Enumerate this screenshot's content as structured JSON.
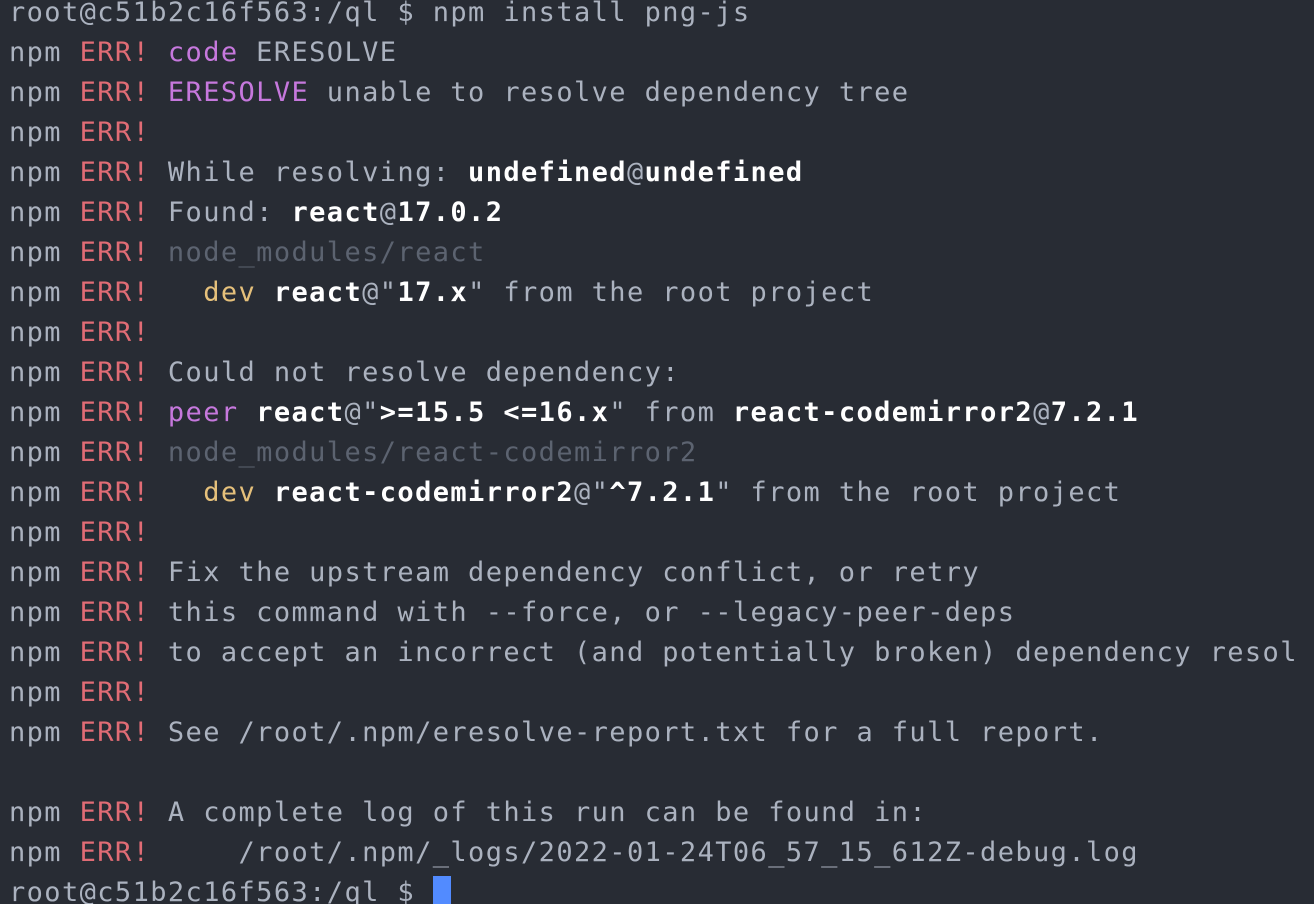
{
  "window": {
    "title": ""
  },
  "colors": {
    "background": "#282c34",
    "default": "#abb2bf",
    "err": "#e06c75",
    "keyword": "#c678dd",
    "bright": "#ffffff",
    "dim": "#5c6370",
    "dev": "#e5c07b",
    "cursor": "#528bff"
  },
  "lines": [
    {
      "segments": [
        {
          "text": "root@c51b2c16f563:/ql $ npm install png-js",
          "style": "default"
        }
      ]
    },
    {
      "segments": [
        {
          "text": "npm ",
          "style": "default"
        },
        {
          "text": "ERR!",
          "style": "err"
        },
        {
          "text": " ",
          "style": "default"
        },
        {
          "text": "code",
          "style": "keyword"
        },
        {
          "text": " ERESOLVE",
          "style": "default"
        }
      ]
    },
    {
      "segments": [
        {
          "text": "npm ",
          "style": "default"
        },
        {
          "text": "ERR!",
          "style": "err"
        },
        {
          "text": " ",
          "style": "default"
        },
        {
          "text": "ERESOLVE",
          "style": "keyword"
        },
        {
          "text": " unable to resolve dependency tree",
          "style": "default"
        }
      ]
    },
    {
      "segments": [
        {
          "text": "npm ",
          "style": "default"
        },
        {
          "text": "ERR!",
          "style": "err"
        }
      ]
    },
    {
      "segments": [
        {
          "text": "npm ",
          "style": "default"
        },
        {
          "text": "ERR!",
          "style": "err"
        },
        {
          "text": " While resolving: ",
          "style": "default"
        },
        {
          "text": "undefined",
          "style": "bright"
        },
        {
          "text": "@",
          "style": "default"
        },
        {
          "text": "undefined",
          "style": "bright"
        }
      ]
    },
    {
      "segments": [
        {
          "text": "npm ",
          "style": "default"
        },
        {
          "text": "ERR!",
          "style": "err"
        },
        {
          "text": " Found: ",
          "style": "default"
        },
        {
          "text": "react",
          "style": "bright"
        },
        {
          "text": "@",
          "style": "default"
        },
        {
          "text": "17.0.2",
          "style": "bright"
        }
      ]
    },
    {
      "segments": [
        {
          "text": "npm ",
          "style": "default"
        },
        {
          "text": "ERR!",
          "style": "err"
        },
        {
          "text": " ",
          "style": "default"
        },
        {
          "text": "node_modules/react",
          "style": "dim"
        }
      ]
    },
    {
      "segments": [
        {
          "text": "npm ",
          "style": "default"
        },
        {
          "text": "ERR!",
          "style": "err"
        },
        {
          "text": "   ",
          "style": "default"
        },
        {
          "text": "dev",
          "style": "dev"
        },
        {
          "text": " ",
          "style": "default"
        },
        {
          "text": "react",
          "style": "bright"
        },
        {
          "text": "@\"",
          "style": "default"
        },
        {
          "text": "17.x",
          "style": "bright"
        },
        {
          "text": "\" from the root project",
          "style": "default"
        }
      ]
    },
    {
      "segments": [
        {
          "text": "npm ",
          "style": "default"
        },
        {
          "text": "ERR!",
          "style": "err"
        }
      ]
    },
    {
      "segments": [
        {
          "text": "npm ",
          "style": "default"
        },
        {
          "text": "ERR!",
          "style": "err"
        },
        {
          "text": " Could not resolve dependency:",
          "style": "default"
        }
      ]
    },
    {
      "segments": [
        {
          "text": "npm ",
          "style": "default"
        },
        {
          "text": "ERR!",
          "style": "err"
        },
        {
          "text": " ",
          "style": "default"
        },
        {
          "text": "peer",
          "style": "keyword"
        },
        {
          "text": " ",
          "style": "default"
        },
        {
          "text": "react",
          "style": "bright"
        },
        {
          "text": "@\"",
          "style": "default"
        },
        {
          "text": ">=15.5 <=16.x",
          "style": "bright"
        },
        {
          "text": "\" from ",
          "style": "default"
        },
        {
          "text": "react-codemirror2",
          "style": "bright"
        },
        {
          "text": "@",
          "style": "default"
        },
        {
          "text": "7.2.1",
          "style": "bright"
        }
      ]
    },
    {
      "segments": [
        {
          "text": "npm ",
          "style": "default"
        },
        {
          "text": "ERR!",
          "style": "err"
        },
        {
          "text": " ",
          "style": "default"
        },
        {
          "text": "node_modules/react-codemirror2",
          "style": "dim"
        }
      ]
    },
    {
      "segments": [
        {
          "text": "npm ",
          "style": "default"
        },
        {
          "text": "ERR!",
          "style": "err"
        },
        {
          "text": "   ",
          "style": "default"
        },
        {
          "text": "dev",
          "style": "dev"
        },
        {
          "text": " ",
          "style": "default"
        },
        {
          "text": "react-codemirror2",
          "style": "bright"
        },
        {
          "text": "@\"",
          "style": "default"
        },
        {
          "text": "^7.2.1",
          "style": "bright"
        },
        {
          "text": "\" from the root project",
          "style": "default"
        }
      ]
    },
    {
      "segments": [
        {
          "text": "npm ",
          "style": "default"
        },
        {
          "text": "ERR!",
          "style": "err"
        }
      ]
    },
    {
      "segments": [
        {
          "text": "npm ",
          "style": "default"
        },
        {
          "text": "ERR!",
          "style": "err"
        },
        {
          "text": " Fix the upstream dependency conflict, or retry",
          "style": "default"
        }
      ]
    },
    {
      "segments": [
        {
          "text": "npm ",
          "style": "default"
        },
        {
          "text": "ERR!",
          "style": "err"
        },
        {
          "text": " this command with --force, or --legacy-peer-deps",
          "style": "default"
        }
      ]
    },
    {
      "segments": [
        {
          "text": "npm ",
          "style": "default"
        },
        {
          "text": "ERR!",
          "style": "err"
        },
        {
          "text": " to accept an incorrect (and potentially broken) dependency resol",
          "style": "default"
        }
      ]
    },
    {
      "segments": [
        {
          "text": "npm ",
          "style": "default"
        },
        {
          "text": "ERR!",
          "style": "err"
        }
      ]
    },
    {
      "segments": [
        {
          "text": "npm ",
          "style": "default"
        },
        {
          "text": "ERR!",
          "style": "err"
        },
        {
          "text": " See /root/.npm/eresolve-report.txt for a full report.",
          "style": "default"
        }
      ]
    },
    {
      "segments": []
    },
    {
      "segments": [
        {
          "text": "npm ",
          "style": "default"
        },
        {
          "text": "ERR!",
          "style": "err"
        },
        {
          "text": " A complete log of this run can be found in:",
          "style": "default"
        }
      ]
    },
    {
      "segments": [
        {
          "text": "npm ",
          "style": "default"
        },
        {
          "text": "ERR!",
          "style": "err"
        },
        {
          "text": "     /root/.npm/_logs/2022-01-24T06_57_15_612Z-debug.log",
          "style": "default"
        }
      ]
    },
    {
      "segments": [
        {
          "text": "root@c51b2c16f563:/ql $ ",
          "style": "default"
        }
      ],
      "cursor": true
    }
  ]
}
